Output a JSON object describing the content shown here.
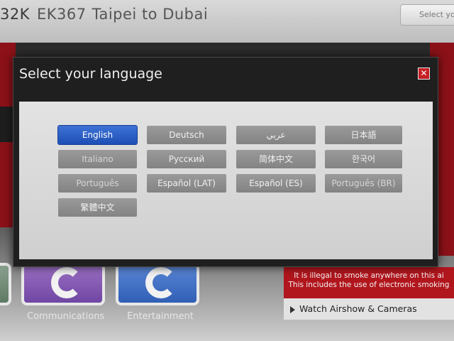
{
  "header": {
    "flight_prefix": "32K",
    "flight_code": "EK367",
    "route": "Taipei to Dubai",
    "language_button_label": "Select you"
  },
  "modal": {
    "title": "Select your language",
    "close_label": "✕",
    "languages": [
      {
        "label": "English",
        "selected": true
      },
      {
        "label": "Deutsch"
      },
      {
        "label": "عربي"
      },
      {
        "label": "日本語"
      },
      {
        "label": "Italiano"
      },
      {
        "label": "Русский"
      },
      {
        "label": "简体中文"
      },
      {
        "label": "한국어"
      },
      {
        "label": "Português"
      },
      {
        "label": "Español (LAT)"
      },
      {
        "label": "Español (ES)"
      },
      {
        "label": "Português (BR)"
      },
      {
        "label": "繁體中文"
      }
    ]
  },
  "tiles": {
    "communications": "Communications",
    "entertainment": "Entertainment"
  },
  "notice": {
    "line1": "It is illegal to smoke anywhere on this ai",
    "line2": "This includes the use of electronic smoking"
  },
  "watch_link": "Watch Airshow & Cameras",
  "colors": {
    "selected_blue": "#1d4fb4",
    "brand_red": "#b1161d",
    "close_red": "#c61f24"
  }
}
